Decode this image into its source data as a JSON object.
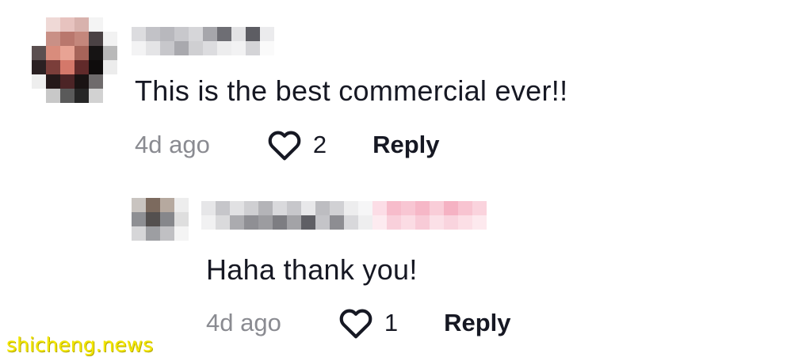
{
  "comment": {
    "text": "This is the best commercial ever!!",
    "timestamp": "4d ago",
    "like_count": "2",
    "reply_label": "Reply"
  },
  "reply": {
    "text": "Haha thank you!",
    "timestamp": "4d ago",
    "like_count": "1",
    "reply_label": "Reply"
  },
  "watermark": "shicheng.news",
  "icons": {
    "like": "heart-outline-icon"
  },
  "colors": {
    "text": "#161823",
    "muted": "#8a8b91",
    "watermark": "#f2e600",
    "username_highlight": "#f7a8bd"
  }
}
